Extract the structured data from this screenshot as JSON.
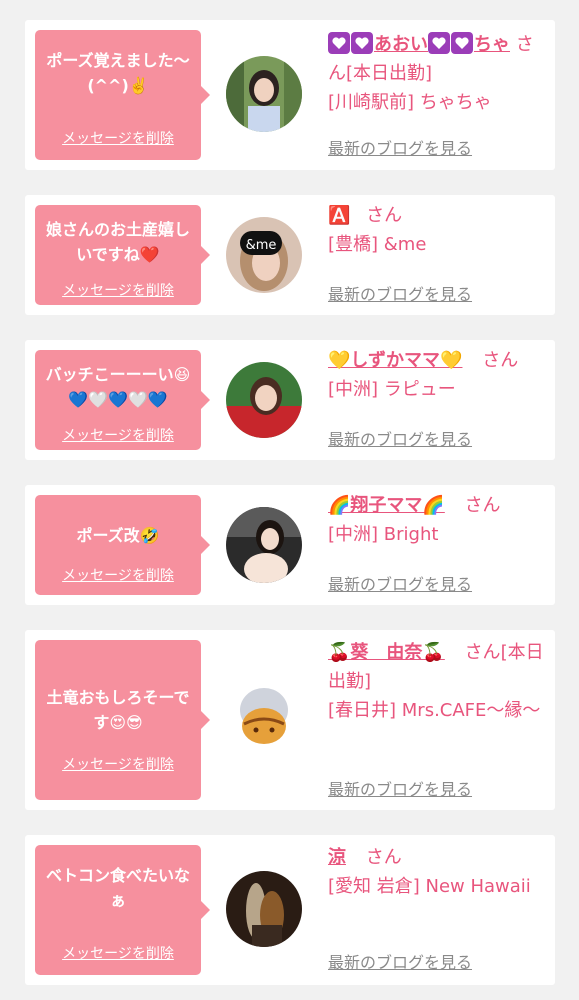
{
  "delete_label": "メッセージを削除",
  "blog_label": "最新のブログを見る",
  "san": "さん",
  "cards": [
    {
      "message": "ポーズ覚えました〜(^^)✌️",
      "name": "あおい",
      "name_suffix": "ちゃ",
      "shift": "[本日出勤]",
      "shop": "[川崎駅前] ちゃちゃ"
    },
    {
      "message": "娘さんのお土産嬉しいですね❤️",
      "name_icon": "🅰️",
      "shop": "[豊橋] &me"
    },
    {
      "message": "バッチこーーーい😆💙🤍💙🤍💙",
      "name": "💛しずかママ💛",
      "shop": "[中洲] ラピュー"
    },
    {
      "message": "ポーズ改🤣",
      "name": "🌈翔子ママ🌈",
      "shop": "[中洲] Bright"
    },
    {
      "message": "土竜おもしろそーです😍😎",
      "name": "🍒葵　由奈🍒",
      "shift": "[本日出勤]",
      "shop": "[春日井] Mrs.CAFE〜縁〜"
    },
    {
      "message": "ベトコン食べたいなぁ",
      "name": "涼",
      "shop": "[愛知 岩倉] New Hawaii"
    }
  ]
}
